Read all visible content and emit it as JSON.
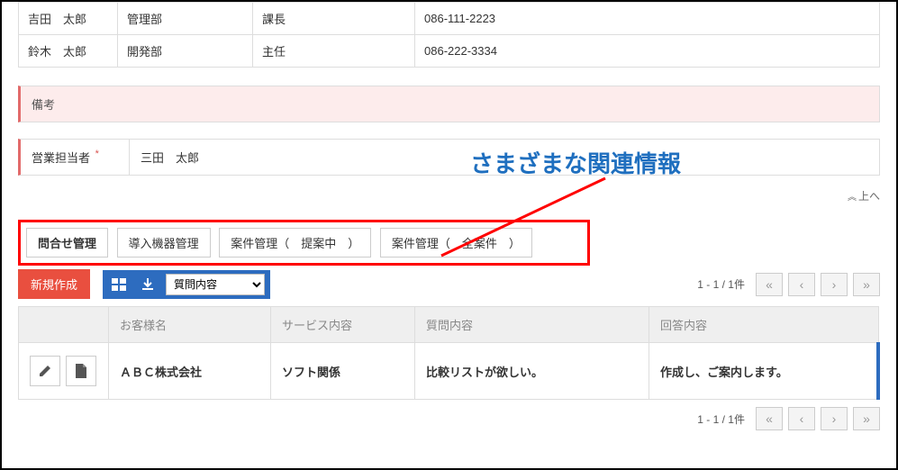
{
  "contacts": [
    {
      "name": "吉田　太郎",
      "dept": "管理部",
      "title": "課長",
      "phone": "086-111-2223"
    },
    {
      "name": "鈴木　太郎",
      "dept": "開発部",
      "title": "主任",
      "phone": "086-222-3334"
    }
  ],
  "notes": {
    "label": "備考"
  },
  "sales": {
    "label": "営業担当者",
    "required_mark": "*",
    "value": "三田　太郎"
  },
  "annotation": {
    "text": "さまざまな関連情報"
  },
  "to_top": {
    "label": "上へ",
    "chevron": "︽"
  },
  "tabs": [
    {
      "label": "問合せ管理",
      "active": true
    },
    {
      "label": "導入機器管理",
      "active": false
    },
    {
      "label": "案件管理（　提案中　）",
      "active": false
    },
    {
      "label": "案件管理（　全案件　）",
      "active": false
    }
  ],
  "toolbar": {
    "new_label": "新規作成",
    "search_select": "質問内容",
    "search_options": [
      "質問内容"
    ]
  },
  "pager": {
    "range_text": "1 - 1 / 1件",
    "first": "«",
    "prev": "‹",
    "next": "›",
    "last": "»"
  },
  "results": {
    "headers": {
      "customer": "お客様名",
      "service": "サービス内容",
      "question": "質問内容",
      "answer": "回答内容"
    },
    "rows": [
      {
        "customer": "ＡＢＣ株式会社",
        "service": "ソフト関係",
        "question": "比較リストが欲しい。",
        "answer": "作成し、ご案内します。"
      }
    ]
  },
  "icons": {
    "grid": "grid",
    "download": "download",
    "pencil": "pencil",
    "file": "file"
  }
}
